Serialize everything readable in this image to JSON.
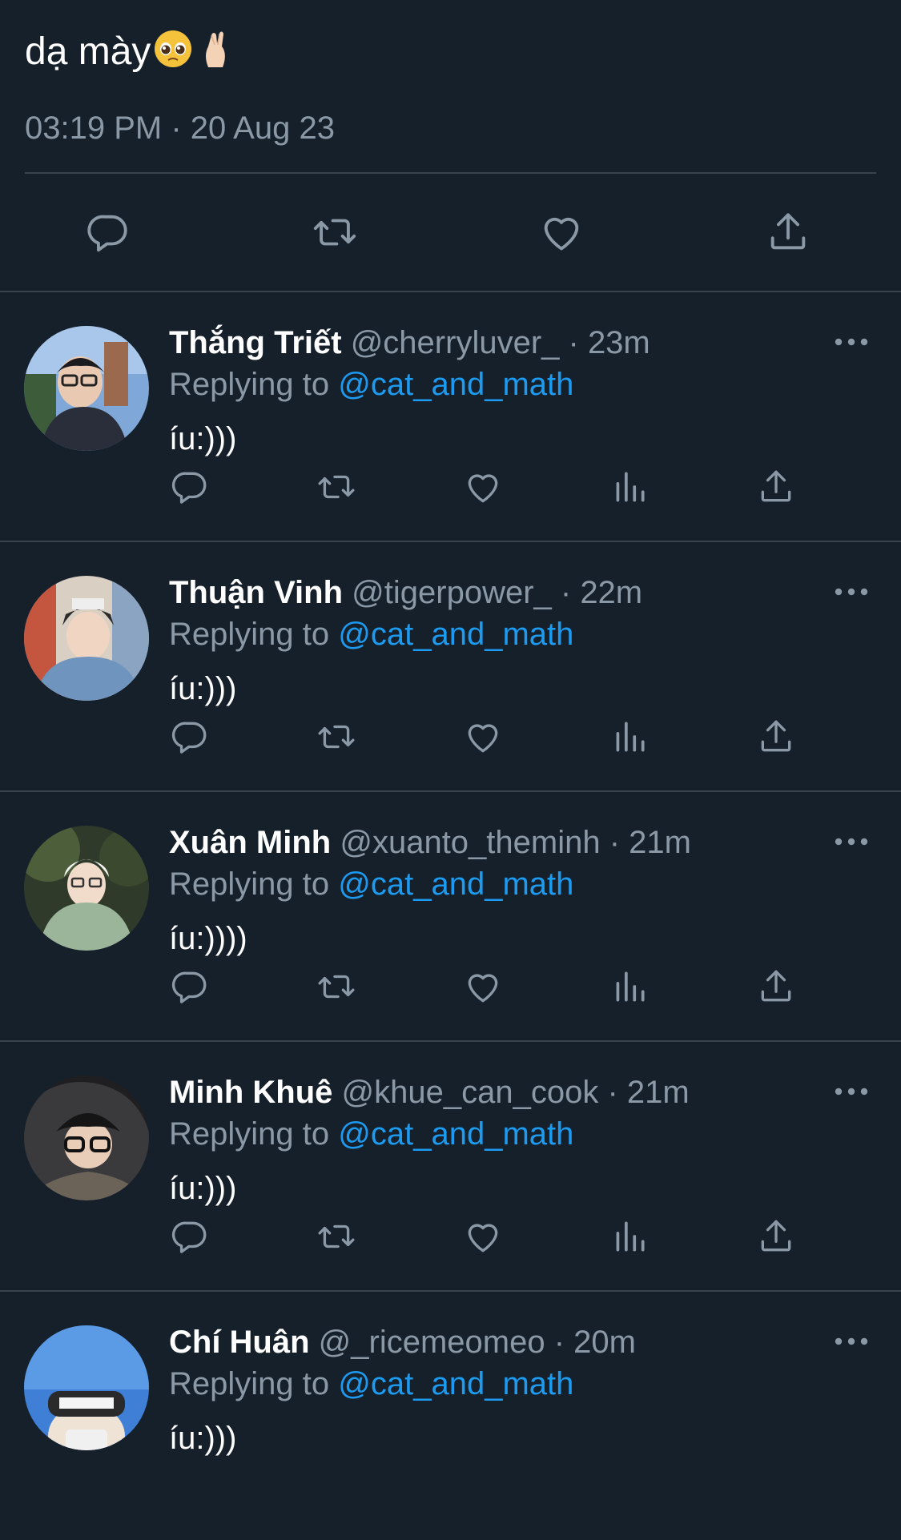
{
  "main_tweet": {
    "text": "dạ mày",
    "emojis": [
      "pleading-face-emoji",
      "pinched-fingers-emoji"
    ],
    "timestamp": "03:19 PM · 20 Aug 23",
    "actions": [
      "reply-icon",
      "retweet-icon",
      "like-icon",
      "share-icon"
    ]
  },
  "colors": {
    "background": "#15202b",
    "text": "#ffffff",
    "secondary": "#8b98a5",
    "accent": "#1d9bf0",
    "divider": "#38444d"
  },
  "replies": [
    {
      "name": "Thắng Triết",
      "handle": "@cherryluver_",
      "time": "23m",
      "replying_prefix": "Replying to",
      "replying_to": "@cat_and_math",
      "text": "íu:)))"
    },
    {
      "name": "Thuận Vinh",
      "handle": "@tigerpower_",
      "time": "22m",
      "replying_prefix": "Replying to",
      "replying_to": "@cat_and_math",
      "text": "íu:)))"
    },
    {
      "name": "Xuân Minh",
      "handle": "@xuanto_theminh",
      "time": "21m",
      "replying_prefix": "Replying to",
      "replying_to": "@cat_and_math",
      "text": "íu:))))"
    },
    {
      "name": "Minh Khuê",
      "handle": "@khue_can_cook",
      "time": "21m",
      "replying_prefix": "Replying to",
      "replying_to": "@cat_and_math",
      "text": "íu:)))"
    },
    {
      "name": "Chí Huân",
      "handle": "@_ricemeomeo",
      "time": "20m",
      "replying_prefix": "Replying to",
      "replying_to": "@cat_and_math",
      "text": "íu:)))"
    }
  ],
  "reply_actions": [
    "reply-icon",
    "retweet-icon",
    "like-icon",
    "views-icon",
    "share-icon"
  ]
}
